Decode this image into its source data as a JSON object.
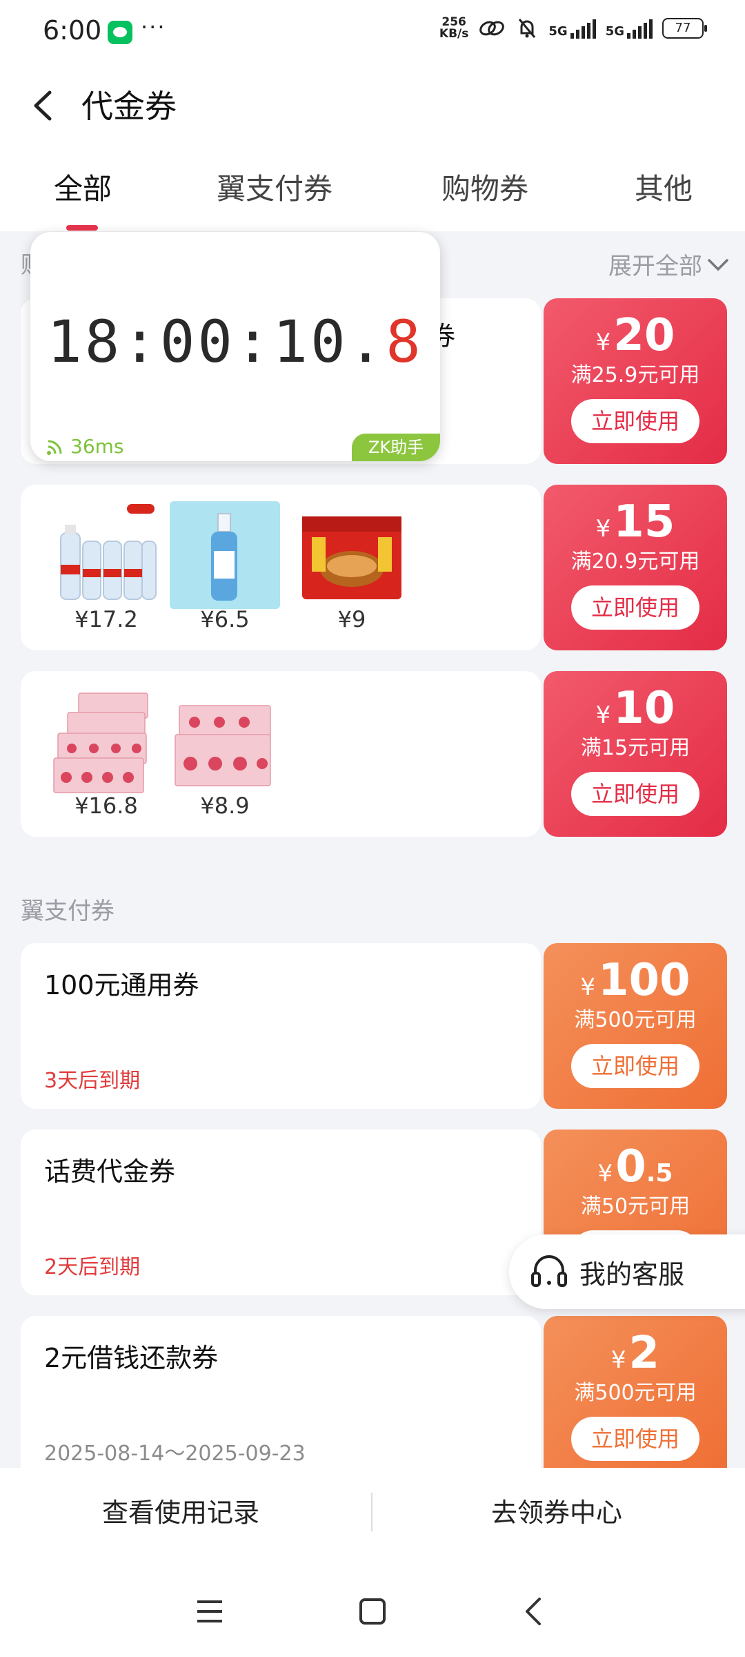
{
  "status": {
    "time": "6:00",
    "netspeed_top": "256",
    "netspeed_bottom": "KB/s",
    "sim1": "5G",
    "sim2": "5G",
    "battery": "77"
  },
  "header": {
    "title": "代金券"
  },
  "tabs": [
    {
      "label": "全部",
      "active": true
    },
    {
      "label": "翼支付券"
    },
    {
      "label": "购物券"
    },
    {
      "label": "其他"
    }
  ],
  "shopping_section": {
    "expand_label": "展开全部"
  },
  "timer": {
    "display_main": "18:00:10.",
    "display_last": "8",
    "latency": "36ms",
    "badge": "ZK助手"
  },
  "shopping_coupons": [
    {
      "currency": "¥",
      "amount": "20",
      "condition": "满25.9元可用",
      "use_label": "立即使用"
    },
    {
      "currency": "¥",
      "amount": "15",
      "condition": "满20.9元可用",
      "use_label": "立即使用",
      "products": [
        {
          "price": "¥17.2"
        },
        {
          "price": "¥6.5"
        },
        {
          "price": "¥9"
        }
      ]
    },
    {
      "currency": "¥",
      "amount": "10",
      "condition": "满15元可用",
      "use_label": "立即使用",
      "products": [
        {
          "price": "¥16.8"
        },
        {
          "price": "¥8.9"
        }
      ]
    }
  ],
  "pay_section": {
    "label": "翼支付券"
  },
  "pay_coupons": [
    {
      "title": "100元通用券",
      "expiry": "3天后到期",
      "currency": "¥",
      "amount": "100",
      "condition": "满500元可用",
      "use_label": "立即使用"
    },
    {
      "title": "话费代金券",
      "expiry": "2天后到期",
      "currency": "¥",
      "amount": "0",
      "amount_decimal": ".5",
      "condition": "满50元可用"
    },
    {
      "title": "2元借钱还款券",
      "dates": "2025-08-14～2025-09-23",
      "currency": "¥",
      "amount": "2",
      "condition": "满500元可用",
      "use_label": "立即使用"
    }
  ],
  "service": {
    "label": "我的客服"
  },
  "bottom": {
    "records": "查看使用记录",
    "center": "去领券中心"
  },
  "colors": {
    "accent_red": "#e42c46",
    "accent_orange": "#ef6f35",
    "timer_green": "#8cc63f"
  }
}
